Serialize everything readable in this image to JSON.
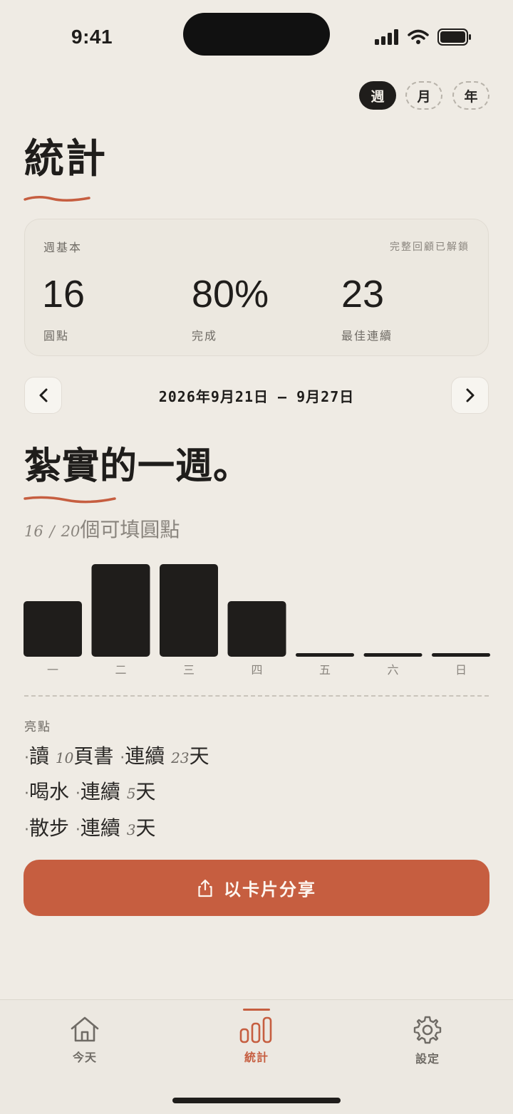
{
  "status": {
    "time": "9:41"
  },
  "period_tabs": [
    {
      "label": "週",
      "active": true
    },
    {
      "label": "月",
      "active": false
    },
    {
      "label": "年",
      "active": false
    }
  ],
  "page_title": "統計",
  "basics": {
    "label": "週基本",
    "note": "完整回顧已解鎖",
    "metrics": [
      {
        "value": "16",
        "label": "圓點"
      },
      {
        "value": "80%",
        "label": "完成"
      },
      {
        "value": "23",
        "label": "最佳連續"
      }
    ]
  },
  "week_nav": {
    "date_range": "2026年9月21日 – 9月27日"
  },
  "headline": "紮實的一週。",
  "summary": {
    "filled": "16",
    "sep": "/",
    "total": "20",
    "suffix": "個可填圓點"
  },
  "chart_data": {
    "type": "bar",
    "categories": [
      "一",
      "二",
      "三",
      "四",
      "五",
      "六",
      "日"
    ],
    "values": [
      3,
      5,
      5,
      3,
      0,
      0,
      0
    ],
    "ylim": [
      0,
      5
    ],
    "bar_color": "#1f1d1b",
    "grid": false
  },
  "highlights": {
    "title": "亮點",
    "items": [
      {
        "dot": "·",
        "pre": "讀 ",
        "num1": "10",
        "mid": "頁書 ",
        "dot2": "·",
        "streak": "連續 ",
        "num2": "23",
        "unit": "天"
      },
      {
        "dot": "·",
        "pre": "喝水 ",
        "num1": "",
        "mid": "",
        "dot2": "·",
        "streak": "連續 ",
        "num2": "5",
        "unit": "天"
      },
      {
        "dot": "·",
        "pre": "散步 ",
        "num1": "",
        "mid": "",
        "dot2": "·",
        "streak": "連續 ",
        "num2": "3",
        "unit": "天"
      }
    ]
  },
  "share_button": {
    "label": "以卡片分享",
    "icon": "share-icon"
  },
  "tabs": [
    {
      "label": "今天",
      "icon": "home-icon",
      "active": false
    },
    {
      "label": "統計",
      "icon": "bar-chart-icon",
      "active": true
    },
    {
      "label": "設定",
      "icon": "gear-icon",
      "active": false
    }
  ],
  "colors": {
    "accent": "#c65e40",
    "background": "#efebe4",
    "ink": "#1f1d1b"
  }
}
